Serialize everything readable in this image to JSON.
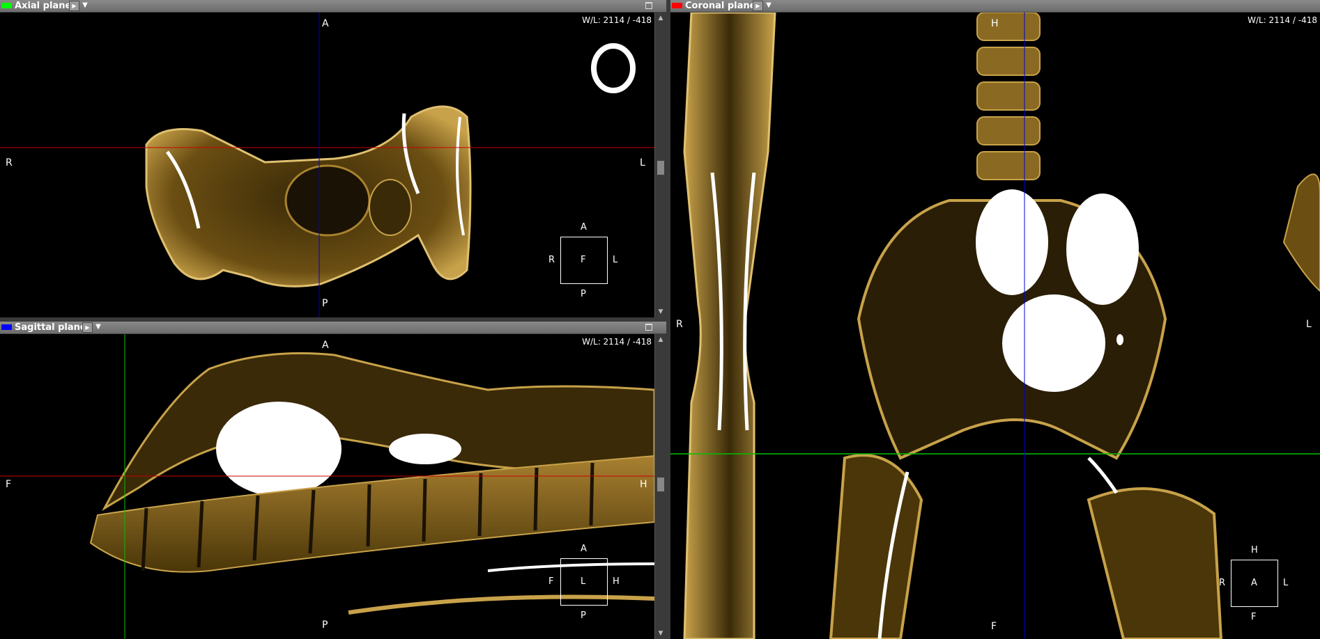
{
  "axial": {
    "title": "Axial plane",
    "color": "#00ff00",
    "wl": "W/L: 2114 / -418",
    "labels": {
      "top": "A",
      "bottom": "P",
      "left": "R",
      "right": "L"
    },
    "cube": {
      "center": "F",
      "top": "A",
      "bottom": "P",
      "left": "R",
      "right": "L"
    }
  },
  "sagittal": {
    "title": "Sagittal plane",
    "color": "#0000ff",
    "wl": "W/L: 2114 / -418",
    "labels": {
      "top": "A",
      "bottom": "P",
      "left": "F",
      "right": "H"
    },
    "cube": {
      "center": "L",
      "top": "A",
      "bottom": "P",
      "left": "F",
      "right": "H"
    }
  },
  "coronal": {
    "title": "Coronal plane",
    "color": "#ff0000",
    "wl": "W/L: 2114 / -418",
    "labels": {
      "top": "H",
      "bottom": "F",
      "left": "R",
      "right": "L"
    },
    "cube": {
      "center": "A",
      "top": "H",
      "bottom": "F",
      "left": "R",
      "right": "L"
    }
  },
  "icons": {
    "play": "play-icon",
    "dropdown": "chevron-down-icon",
    "maximize": "maximize-icon",
    "scroll_up": "arrow-up-icon",
    "scroll_down": "arrow-down-icon"
  },
  "colors": {
    "bone": "#c8a24a",
    "bone_bright": "#ffffff",
    "crosshair_axial": "#00c000",
    "crosshair_coronal": "#cc0000",
    "crosshair_sagittal": "#0000cc"
  }
}
